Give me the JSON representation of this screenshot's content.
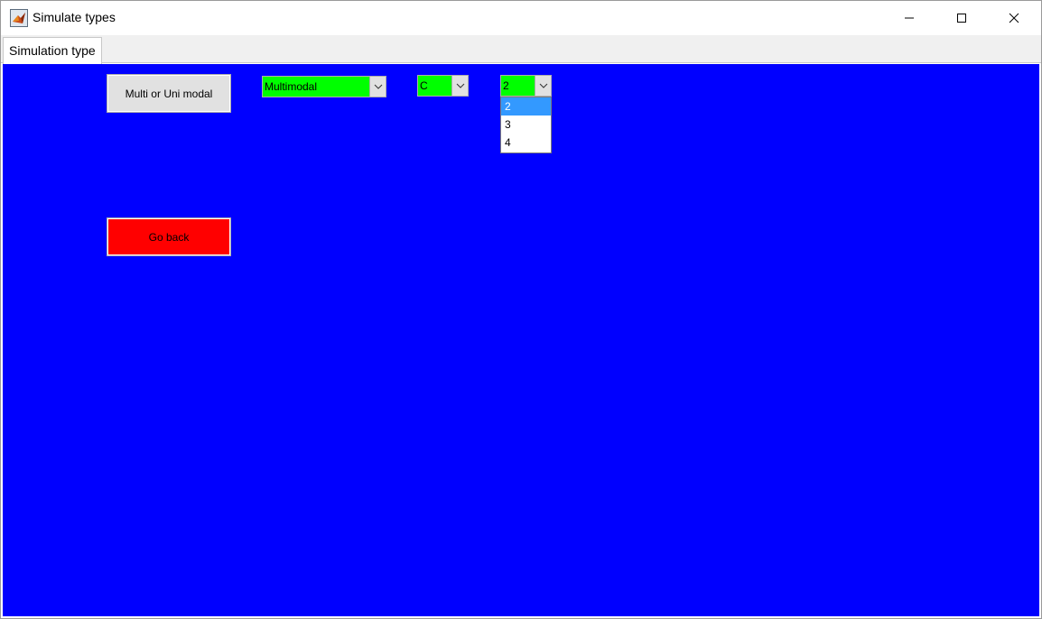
{
  "window": {
    "title": "Simulate types",
    "icon": "matlab-icon",
    "controls": [
      "minimize-icon",
      "maximize-icon",
      "close-icon"
    ]
  },
  "tabs": [
    {
      "label": "Simulation type",
      "selected": true
    }
  ],
  "panel": {
    "background": "#0000ff",
    "mode_button_label": "Multi or Uni modal",
    "go_back_label": "Go back",
    "go_back_color": "#ff0000",
    "mode_dropdown": {
      "value": "Multimodal",
      "color": "#00ff00"
    },
    "letter_dropdown": {
      "value": "C",
      "color": "#00ff00"
    },
    "count_dropdown": {
      "value": "2",
      "color": "#00ff00",
      "expanded": true,
      "options": [
        "2",
        "3",
        "4"
      ],
      "highlighted": "2"
    }
  }
}
